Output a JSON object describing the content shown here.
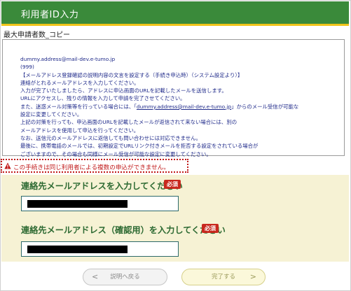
{
  "header": {
    "title": "利用者ID入力"
  },
  "copy_label": "最大申請者数_コピー",
  "message": {
    "lines": [
      "dummy.address@mail-dev.e-tumo.jp",
      "(999)",
      "【メールアドレス登録確認の説明内容の文言を設定する（手続き申込時）（システム設定より）】",
      "連絡がとれるメールアドレスを入力してください。",
      "入力が完了いたしましたら、アドレスに申込画面のURLを記載したメールを送信します。",
      "URLにアクセスし、残りの情報を入力して申請を完了させてください。",
      "また、迷惑メール対策等を行っている場合には、「dummy.address@mail-dev.e-tumo.jp」からのメール受信が可能な",
      "設定に変更してください。",
      "上記の対策を行っても、申込画面のURLを記載したメールが返信されて来ない場合には、別の",
      "メールアドレスを使用して申込を行ってください。",
      "なお、送信元のメールアドレスに返信しても問い合わせには対応できません。",
      "最後に、携帯電話のメールでは、初期設定でURLリンク付きメールを拒否する設定をされている場合が",
      "ございますので、その場合も同様にメール受信が可能な設定に変更してください。"
    ]
  },
  "warning": {
    "text": "この手続きは同じ利用者による複数の申込ができません。"
  },
  "email_field": {
    "label": "連絡先メールアドレスを入力してください",
    "required": "必須",
    "value": ""
  },
  "email_confirm_field": {
    "label": "連絡先メールアドレス（確認用）を入力してください",
    "required": "必須",
    "value": ""
  },
  "buttons": {
    "back": "説明へ戻る",
    "back_arrow": "<",
    "next": "完了する",
    "next_arrow": ">"
  },
  "colors": {
    "header_bg": "#3a8a3a",
    "header_accent": "#f0c419",
    "required_badge": "#c8281e",
    "warning": "#c01818",
    "label": "#2d6a32"
  }
}
